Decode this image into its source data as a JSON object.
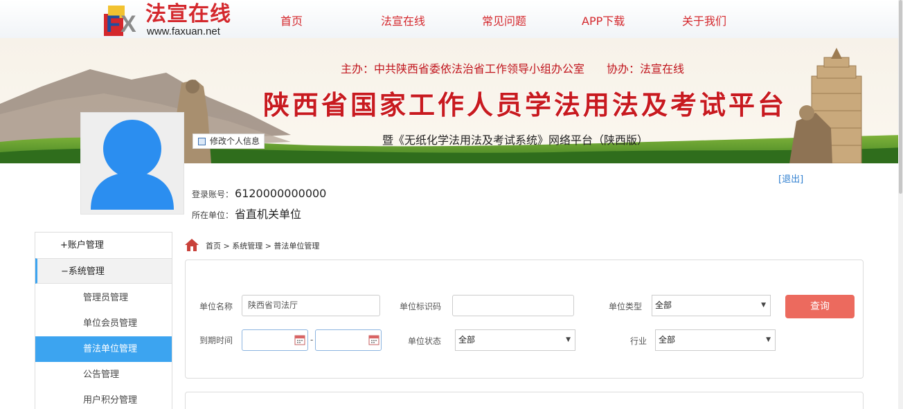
{
  "header": {
    "logo_title": "法宣在线",
    "logo_url": "www.faxuan.net",
    "nav": [
      "首页",
      "法宣在线",
      "常见问题",
      "APP下载",
      "关于我们"
    ],
    "brand_color": "#d4282d"
  },
  "banner": {
    "host": "主办：中共陕西省委依法治省工作领导小组办公室",
    "co_host": "协办：法宣在线",
    "title": "陕西省国家工作人员学法用法及考试平台",
    "subtitle": "暨《无纸化学法用法及考试系统》网络平台（陕西版）"
  },
  "profile": {
    "edit_label": "修改个人信息",
    "logout_label": "[退出]",
    "account_label": "登录账号：",
    "account_value": "6120000000000",
    "unit_label": "所在单位：",
    "unit_value": "省直机关单位"
  },
  "sidebar": {
    "items": [
      {
        "label": "+账户管理",
        "type": "group"
      },
      {
        "label": "−系统管理",
        "type": "group",
        "expanded": true
      },
      {
        "label": "管理员管理",
        "type": "sub"
      },
      {
        "label": "单位会员管理",
        "type": "sub"
      },
      {
        "label": "普法单位管理",
        "type": "sub",
        "active": true
      },
      {
        "label": "公告管理",
        "type": "sub"
      },
      {
        "label": "用户积分管理",
        "type": "sub"
      }
    ],
    "active_color": "#3ca4f0"
  },
  "breadcrumb": "首页 > 系统管理 > 普法单位管理",
  "search": {
    "unit_name_label": "单位名称",
    "unit_name_value": "陕西省司法厅",
    "unit_code_label": "单位标识码",
    "unit_code_value": "",
    "unit_type_label": "单位类型",
    "unit_type_value": "全部",
    "query_label": "查询",
    "query_color": "#ec6a5e",
    "expire_label": "到期时间",
    "expire_from": "",
    "expire_to": "",
    "dash": "-",
    "status_label": "单位状态",
    "status_value": "全部",
    "industry_label": "行业",
    "industry_value": "全部"
  }
}
